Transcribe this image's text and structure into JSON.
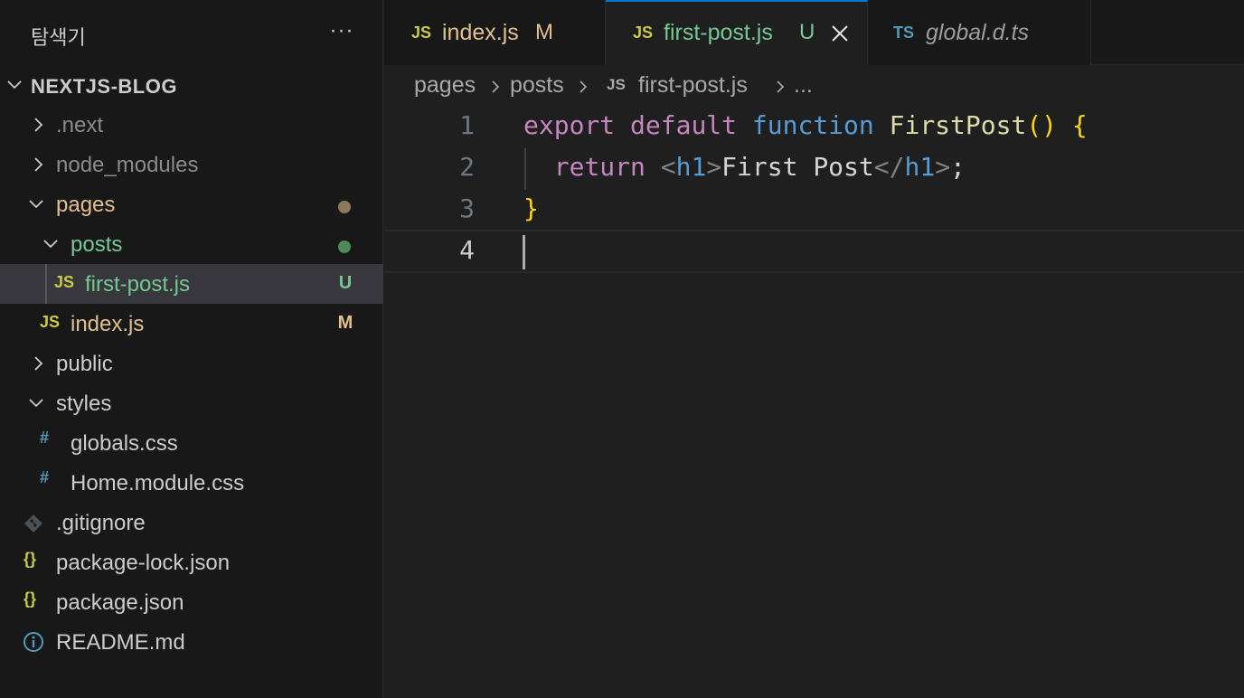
{
  "sidebar": {
    "title": "탐색기",
    "more": "···",
    "project": "NEXTJS-BLOG",
    "items": [
      {
        "label": ".next",
        "icon": "chevron-right-icon"
      },
      {
        "label": "node_modules",
        "icon": "chevron-right-icon"
      },
      {
        "label": "pages",
        "icon": "chevron-down-icon",
        "status_dot": "#8a7a5a"
      },
      {
        "label": "posts",
        "icon": "chevron-down-icon",
        "status_dot": "#4d8a5a"
      },
      {
        "label": "first-post.js",
        "icon": "js-icon",
        "icon_text": "JS",
        "status": "U"
      },
      {
        "label": "index.js",
        "icon": "js-icon",
        "icon_text": "JS",
        "status": "M"
      },
      {
        "label": "public",
        "icon": "chevron-right-icon"
      },
      {
        "label": "styles",
        "icon": "chevron-down-icon"
      },
      {
        "label": "globals.css",
        "icon": "css-icon",
        "icon_text": "#"
      },
      {
        "label": "Home.module.css",
        "icon": "css-icon",
        "icon_text": "#"
      },
      {
        "label": ".gitignore",
        "icon": "git-icon"
      },
      {
        "label": "package-lock.json",
        "icon": "json-icon",
        "icon_text": "{}"
      },
      {
        "label": "package.json",
        "icon": "json-icon",
        "icon_text": "{}"
      },
      {
        "label": "README.md",
        "icon": "info-icon"
      }
    ]
  },
  "tabs": [
    {
      "icon_text": "JS",
      "name": "index.js",
      "status": "M"
    },
    {
      "icon_text": "JS",
      "name": "first-post.js",
      "status": "U",
      "active": true
    },
    {
      "icon_text": "TS",
      "name": "global.d.ts"
    }
  ],
  "breadcrumb": {
    "parts": [
      "pages",
      "posts",
      "first-post.js",
      "..."
    ],
    "file_icon_text": "JS"
  },
  "editor": {
    "line_numbers": [
      "1",
      "2",
      "3",
      "4"
    ],
    "line1": {
      "export": "export",
      "default": "default",
      "function": "function",
      "name": "FirstPost",
      "parens": "()",
      "brace": "{"
    },
    "line2": {
      "return": "return",
      "open_lt": "<",
      "tag1": "h1",
      "gt1": ">",
      "text": "First Post",
      "close_lt": "</",
      "tag2": "h1",
      "gt2": ">",
      "semi": ";"
    },
    "line3": {
      "brace": "}"
    }
  },
  "colors": {
    "accent": "#0078d4",
    "untracked": "#73c991",
    "modified": "#e2c08d"
  }
}
